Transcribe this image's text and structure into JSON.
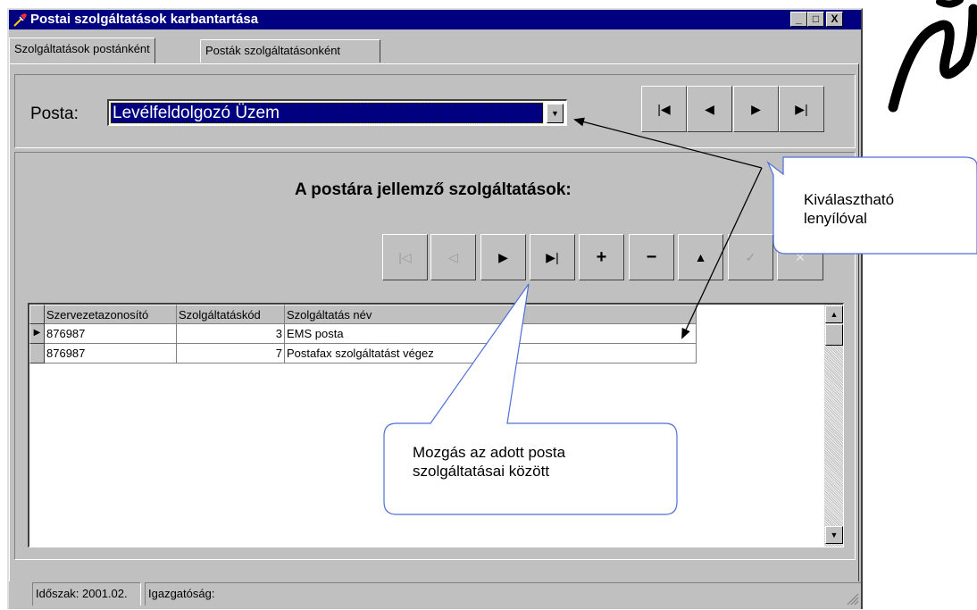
{
  "window": {
    "title": "Postai szolgáltatások karbantartása",
    "controls": {
      "minimize": "_",
      "maximize": "□",
      "close": "X"
    }
  },
  "tabs": [
    {
      "label": "Szolgáltatások postánként",
      "active": true
    },
    {
      "label": "Posták szolgáltatásonként",
      "active": false
    }
  ],
  "posta": {
    "label": "Posta:",
    "selected": "Levélfeldolgozó Üzem",
    "nav_buttons": [
      "first-icon",
      "prev-icon",
      "next-icon",
      "last-icon"
    ]
  },
  "services": {
    "heading": "A postára jellemző szolgáltatások:",
    "nav_buttons": [
      {
        "icon": "first-icon",
        "enabled": false
      },
      {
        "icon": "prev-icon",
        "enabled": false
      },
      {
        "icon": "next-icon",
        "enabled": true
      },
      {
        "icon": "last-icon",
        "enabled": true
      },
      {
        "icon": "insert-icon",
        "enabled": true
      },
      {
        "icon": "delete-icon",
        "enabled": true
      },
      {
        "icon": "edit-icon",
        "enabled": true
      },
      {
        "icon": "post-icon",
        "enabled": false
      },
      {
        "icon": "cancel-icon",
        "enabled": false
      }
    ]
  },
  "grid": {
    "columns": [
      "Szervezetazonosító",
      "Szolgáltatáskód",
      "Szolgáltatás név"
    ],
    "rows": [
      [
        "876987",
        "3",
        "EMS posta"
      ],
      [
        "876987",
        "7",
        "Postafax szolgáltatást végez"
      ]
    ]
  },
  "status": {
    "period": "Időszak: 2001.02.",
    "directorate": "Igazgatóság:"
  },
  "callouts": {
    "dropdown": [
      "Kiválasztható",
      "lenyílóval"
    ],
    "navigation": [
      "Mozgás az adott posta",
      "szolgáltatásai között"
    ]
  },
  "colors": {
    "titlebar": "#000080",
    "face": "#c0c0c0",
    "callout_border": "#4f6fd8",
    "selection": "#000080"
  }
}
